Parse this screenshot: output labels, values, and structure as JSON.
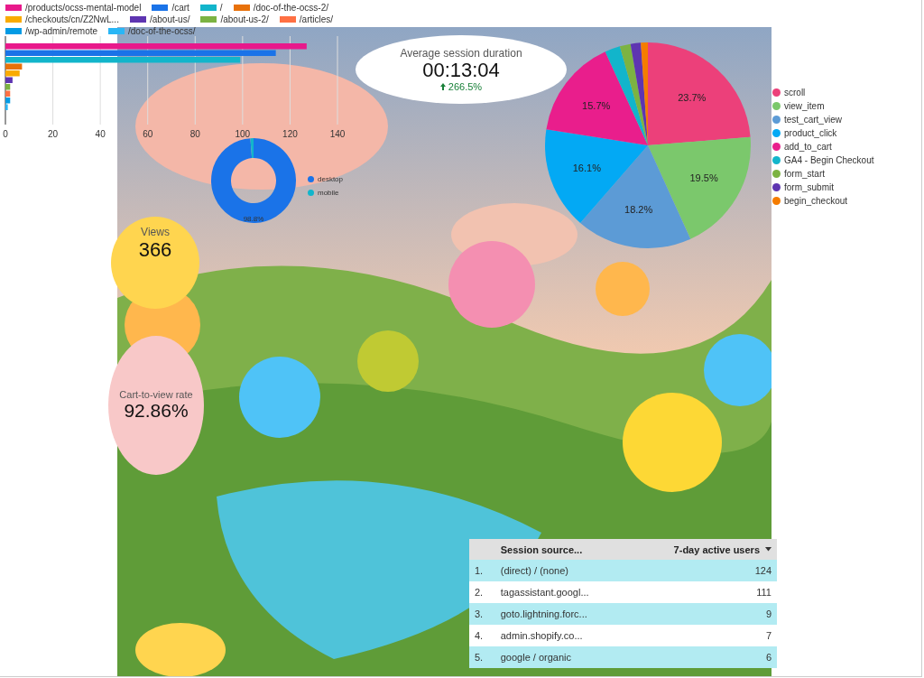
{
  "page_views_chart": {
    "chart_data": {
      "type": "bar",
      "orientation": "horizontal",
      "grid": true,
      "xlim": [
        0,
        140
      ],
      "xticks": [
        0,
        20,
        40,
        60,
        80,
        100,
        120,
        140
      ],
      "series": [
        {
          "name": "/products/ocss-mental-model",
          "color": "#e8198b",
          "values": [
            127
          ]
        },
        {
          "name": "/cart",
          "color": "#1a73e8",
          "values": [
            114
          ]
        },
        {
          "name": "/",
          "color": "#12b5cb",
          "values": [
            99
          ]
        },
        {
          "name": "/doc-of-the-ocss-2/",
          "color": "#e8710a",
          "values": [
            7
          ]
        },
        {
          "name": "/checkouts/cn/Z2NwL...",
          "color": "#f9ab00",
          "values": [
            6
          ]
        },
        {
          "name": "/about-us/",
          "color": "#5e35b1",
          "values": [
            3
          ]
        },
        {
          "name": "/about-us-2/",
          "color": "#7cb342",
          "values": [
            2
          ]
        },
        {
          "name": "/articles/",
          "color": "#ff7043",
          "values": [
            2
          ]
        },
        {
          "name": "/wp-admin/remote",
          "color": "#039be5",
          "values": [
            2
          ]
        },
        {
          "name": "/doc-of-the-ocss/",
          "color": "#29b6f6",
          "values": [
            1
          ]
        }
      ]
    }
  },
  "session_duration": {
    "label": "Average session duration",
    "value": "00:13:04",
    "change": "266.5%"
  },
  "device_chart": {
    "legend": [
      {
        "color": "#1a73e8"
      },
      {
        "color": "#12b5cb"
      }
    ],
    "chart_data": {
      "type": "donut",
      "categories": [
        "desktop",
        "mobile"
      ],
      "values": [
        98.8,
        1.2
      ],
      "value_labels": [
        "98.8%",
        null
      ]
    }
  },
  "events_chart": {
    "legend": [
      {
        "color": "#ec407a"
      },
      {
        "color": "#7bc86c"
      },
      {
        "color": "#5c9bd6"
      },
      {
        "color": "#03a9f4"
      },
      {
        "color": "#e91e8c"
      },
      {
        "color": "#12b5cb"
      },
      {
        "color": "#7cb342"
      },
      {
        "color": "#5e35b1"
      },
      {
        "color": "#f57c00"
      }
    ],
    "chart_data": {
      "type": "pie",
      "categories": [
        "scroll",
        "view_item",
        "test_cart_view",
        "product_click",
        "add_to_cart",
        "GA4 - Begin Checkout",
        "form_start",
        "form_submit",
        "begin_checkout"
      ],
      "values": [
        23.7,
        19.5,
        18.2,
        16.1,
        15.7,
        2.4,
        1.7,
        1.6,
        1.1
      ],
      "value_labels": [
        "23.7%",
        "19.5%",
        "18.2%",
        "16.1%",
        "15.7%",
        null,
        null,
        null,
        null
      ]
    }
  },
  "views": {
    "label": "Views",
    "value": "366"
  },
  "cart_to_view": {
    "label": "Cart-to-view rate",
    "value": "92.86%"
  },
  "sources_table": {
    "columns": [
      {
        "label": "Session source..."
      },
      {
        "label": "7-day active users",
        "sorted": true
      }
    ],
    "rows": [
      {
        "rank": "1.",
        "source": "(direct) / (none)",
        "users": "124"
      },
      {
        "rank": "2.",
        "source": "tagassistant.googl...",
        "users": "111"
      },
      {
        "rank": "3.",
        "source": "goto.lightning.forc...",
        "users": "9"
      },
      {
        "rank": "4.",
        "source": "admin.shopify.co...",
        "users": "7"
      },
      {
        "rank": "5.",
        "source": "google / organic",
        "users": "6"
      }
    ]
  }
}
